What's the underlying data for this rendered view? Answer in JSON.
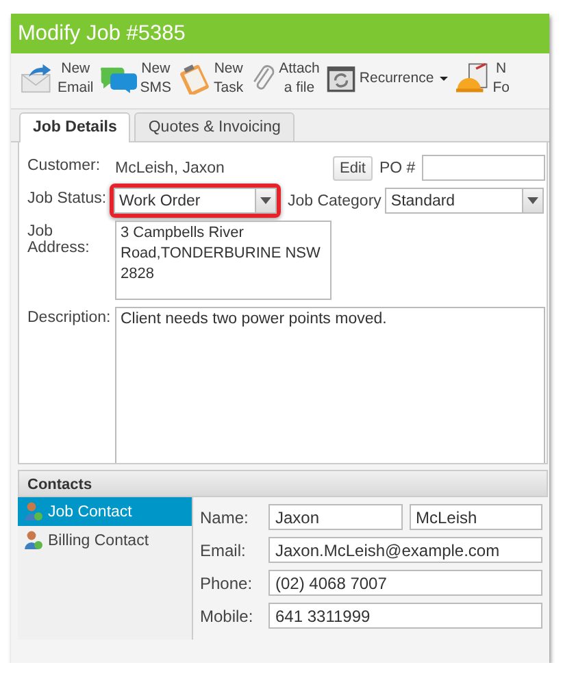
{
  "window": {
    "title": "Modify Job #5385"
  },
  "toolbar": [
    {
      "kind": "email",
      "lines": [
        "New",
        "Email"
      ],
      "dropdown": false
    },
    {
      "kind": "sms",
      "lines": [
        "New",
        "SMS"
      ],
      "dropdown": false
    },
    {
      "kind": "task",
      "lines": [
        "New",
        "Task"
      ],
      "dropdown": false
    },
    {
      "kind": "attach",
      "lines": [
        "Attach",
        "a file"
      ],
      "dropdown": false
    },
    {
      "kind": "recurrence",
      "lines": [
        "Recurrence"
      ],
      "dropdown": true
    },
    {
      "kind": "helmet",
      "lines": [
        "N",
        "Fo"
      ],
      "dropdown": false
    }
  ],
  "tabs": [
    {
      "label": "Job Details",
      "selected": true
    },
    {
      "label": "Quotes & Invoicing",
      "selected": false
    }
  ],
  "form": {
    "customer": {
      "label": "Customer:",
      "value": "McLeish, Jaxon",
      "button": "Edit"
    },
    "po": {
      "label": "PO #"
    },
    "job_status": {
      "label": "Job Status:",
      "value": "Work Order",
      "highlighted": true
    },
    "job_category": {
      "label": "Job Category",
      "value": "Standard"
    },
    "job_address": {
      "label": "Job Address:",
      "value": "3 Campbells River Road,TONDERBURINE NSW 2828"
    },
    "description": {
      "label": "Description:",
      "value": "Client needs two power points moved."
    }
  },
  "contacts": {
    "title": "Contacts",
    "items": [
      {
        "label": "Job Contact",
        "selected": true
      },
      {
        "label": "Billing Contact",
        "selected": false
      }
    ],
    "fields": [
      {
        "label": "Name:",
        "values": [
          "Jaxon",
          "McLeish"
        ]
      },
      {
        "label": "Email:",
        "values": [
          "Jaxon.McLeish@example.com"
        ]
      },
      {
        "label": "Phone:",
        "values": [
          "(02) 4068 7007"
        ]
      },
      {
        "label": "Mobile:",
        "values": [
          "641 3311999"
        ]
      }
    ]
  }
}
